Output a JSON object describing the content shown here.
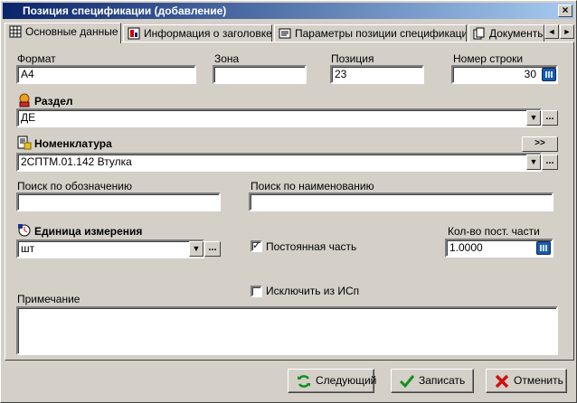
{
  "window": {
    "title": "Позиция спецификации (добавление)",
    "close_label": "×"
  },
  "tabs": [
    {
      "label": "Основные данные",
      "icon": "grid-icon"
    },
    {
      "label": "Информация о заголовке",
      "icon": "header-info-icon"
    },
    {
      "label": "Параметры позиции спецификации",
      "icon": "params-icon"
    },
    {
      "label": "Документы",
      "icon": "documents-icon"
    }
  ],
  "tab_scroll": {
    "left": "◄",
    "right": "►"
  },
  "fields": {
    "format": {
      "label": "Формат",
      "value": "A4"
    },
    "zone": {
      "label": "Зона",
      "value": ""
    },
    "position": {
      "label": "Позиция",
      "value": "23"
    },
    "row_number": {
      "label": "Номер строки",
      "value": "30"
    },
    "section": {
      "label": "Раздел",
      "value": "ДЕ"
    },
    "nomenclature": {
      "label": "Номенклатура",
      "value": "2СПТМ.01.142  Втулка",
      "expand_label": ">>"
    },
    "search_designation": {
      "label": "Поиск по обозначению",
      "value": ""
    },
    "search_name": {
      "label": "Поиск по наименованию",
      "value": ""
    },
    "unit": {
      "label": "Единица измерения",
      "value": "шт"
    },
    "constant_part": {
      "label": "Постоянная часть",
      "checked": true
    },
    "const_qty": {
      "label": "Кол-во пост. части",
      "value": "1.0000"
    },
    "exclude_isp": {
      "label": "Исключить из ИСп",
      "checked": false
    },
    "note": {
      "label": "Примечание",
      "value": ""
    }
  },
  "dropdown_arrow": "▼",
  "ellipsis": "...",
  "check_mark": "✓",
  "buttons": {
    "next": "Следующий",
    "save": "Записать",
    "cancel": "Отменить"
  },
  "colors": {
    "title_start": "#0a246a",
    "title_end": "#a6caf0",
    "face": "#d4d0c8"
  }
}
